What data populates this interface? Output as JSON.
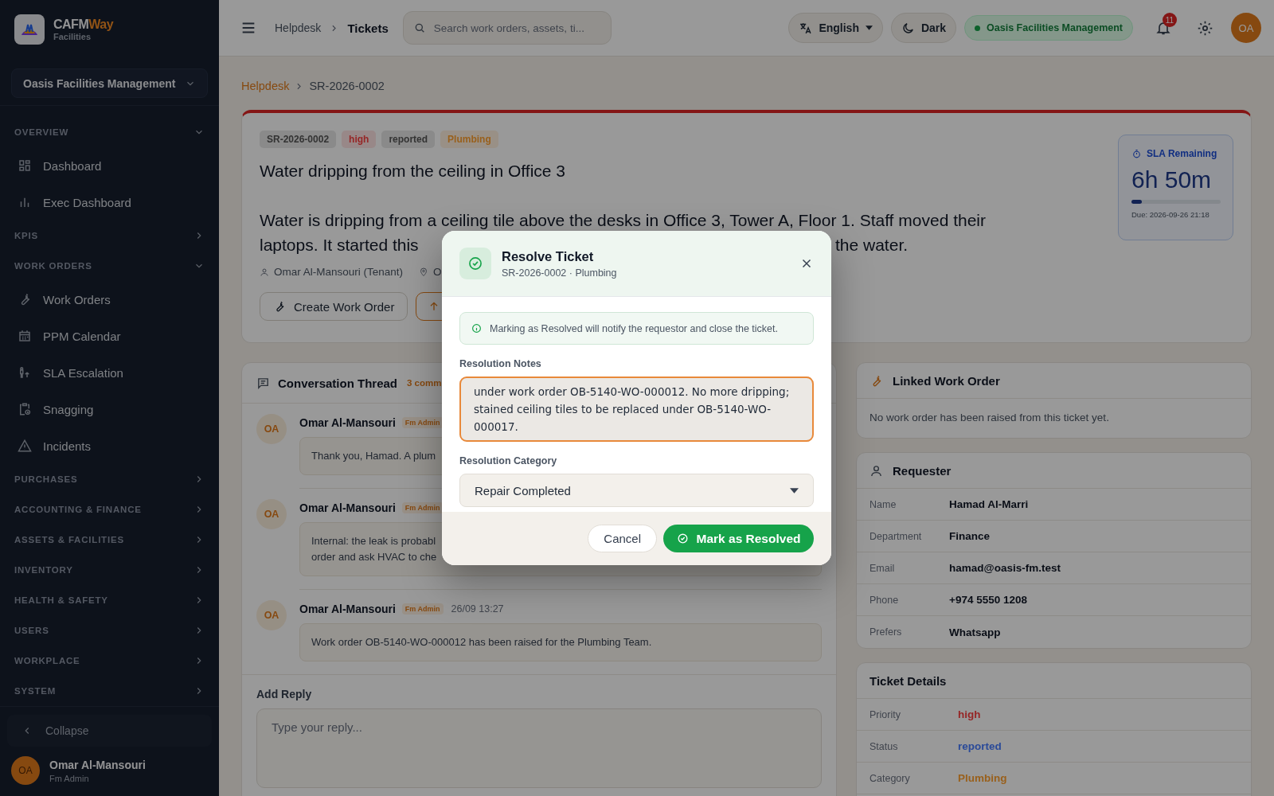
{
  "sidebar": {
    "brand": {
      "name_main": "CAFM",
      "name_accent": "Way",
      "subtitle": "Facilities"
    },
    "org_selector": "Oasis Facilities Management",
    "sections": [
      {
        "title": "OVERVIEW",
        "expanded": true,
        "items": [
          {
            "label": "Dashboard"
          },
          {
            "label": "Exec Dashboard"
          }
        ]
      },
      {
        "title": "KPIS",
        "expanded": false
      },
      {
        "title": "WORK ORDERS",
        "expanded": true,
        "items": [
          {
            "label": "Work Orders"
          },
          {
            "label": "PPM Calendar"
          },
          {
            "label": "SLA Escalation"
          },
          {
            "label": "Snagging"
          },
          {
            "label": "Incidents"
          }
        ]
      },
      {
        "title": "PURCHASES",
        "expanded": false
      },
      {
        "title": "ACCOUNTING & FINANCE",
        "expanded": false
      },
      {
        "title": "ASSETS & FACILITIES",
        "expanded": false
      },
      {
        "title": "INVENTORY",
        "expanded": false
      },
      {
        "title": "HEALTH & SAFETY",
        "expanded": false
      },
      {
        "title": "USERS",
        "expanded": false
      },
      {
        "title": "WORKPLACE",
        "expanded": false
      },
      {
        "title": "SYSTEM",
        "expanded": false
      }
    ],
    "collapse": "Collapse",
    "user": {
      "initials": "OA",
      "name": "Omar Al-Mansouri",
      "role": "Fm Admin"
    }
  },
  "topbar": {
    "breadcrumb": [
      "Helpdesk",
      "Tickets"
    ],
    "search": {
      "placeholder": "Search work orders, assets, ti..."
    },
    "language": "English",
    "theme": "Dark",
    "org_badge": "Oasis Facilities Management",
    "notifications": "11",
    "avatar": "OA"
  },
  "page_breadcrumb": [
    "Helpdesk",
    "SR-2026-0002"
  ],
  "ticket": {
    "tags": [
      {
        "text": "SR-2026-0002",
        "color": "#333333"
      },
      {
        "text": "high",
        "color": "#962626"
      },
      {
        "text": "reported",
        "color": "#333333"
      },
      {
        "text": "Plumbing",
        "color": "#99601c"
      }
    ],
    "title": "Water dripping from the ceiling in Office 3",
    "description": [
      "Water is dripping from a ceiling tile above the desks in Office 3, Tower A, Floor 1. Staff moved their",
      "laptops. It started this",
      "the water."
    ],
    "requester": "Omar Al-Mansouri (Tenant)",
    "location": "O",
    "create_button": "Create Work Order",
    "sla": {
      "label": "SLA Remaining",
      "value": "6h 50m",
      "level": 0.12,
      "due": "Due: 2026-09-26 21:18"
    }
  },
  "conversation": {
    "title": "Conversation Thread",
    "count": "3 comm",
    "messages": [
      {
        "initials": "OA",
        "author": "Omar Al-Mansouri",
        "role": "Fm Admin",
        "body": [
          "Thank you, Hamad. A plum"
        ]
      },
      {
        "initials": "OA",
        "author": "Omar Al-Mansouri",
        "role": "Fm Admin",
        "body": [
          "Internal: the leak is probabl",
          "order and ask HVAC to che"
        ]
      },
      {
        "initials": "OA",
        "author": "Omar Al-Mansouri",
        "role": "Fm Admin",
        "time": "26/09 13:27",
        "body": [
          "Work order OB-5140-WO-000012 has been raised for the Plumbing Team."
        ]
      }
    ],
    "reply_label": "Add Reply",
    "reply_placeholder": "Type your reply..."
  },
  "linked_work_order": {
    "title": "Linked Work Order",
    "empty_text": "No work order has been raised from this ticket yet."
  },
  "requester_card": {
    "title": "Requester",
    "rows": [
      {
        "label": "Name",
        "value": "Hamad Al-Marri"
      },
      {
        "label": "Department",
        "value": "Finance"
      },
      {
        "label": "Email",
        "value": "hamad@oasis-fm.test"
      },
      {
        "label": "Phone",
        "value": "+974 5550 1208"
      },
      {
        "label": "Prefers",
        "value": "Whatsapp"
      }
    ]
  },
  "ticket_details": {
    "title": "Ticket Details",
    "rows": [
      {
        "label": "Priority",
        "value": "high",
        "color": "#962626"
      },
      {
        "label": "Status",
        "value": "reported",
        "color": "#2a4a99"
      },
      {
        "label": "Category",
        "value": "Plumbing",
        "color": "#99601c"
      }
    ]
  },
  "modal": {
    "title": "Resolve Ticket",
    "subtitle": "SR-2026-0002 · Plumbing",
    "notice": "Marking as Resolved will notify the requestor and close the ticket.",
    "notes_label": "Resolution Notes",
    "notes_value": "under work order OB-5140-WO-000012. No more dripping; stained ceiling tiles to be replaced under OB-5140-WO-000017.",
    "category_label": "Resolution Category",
    "category_value": "Repair Completed",
    "cancel": "Cancel",
    "confirm": "Mark as Resolved"
  }
}
